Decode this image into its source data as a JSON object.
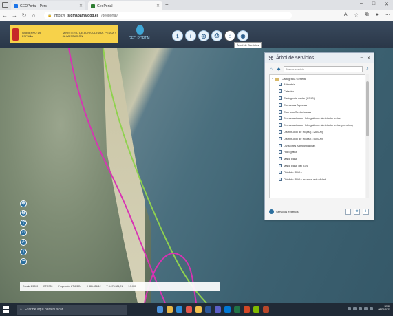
{
  "browser": {
    "tabs": [
      {
        "label": "GEOPortal · Pers",
        "active": false
      },
      {
        "label": "GeoPortal",
        "active": true
      }
    ],
    "url_scheme": "https://",
    "url_host": "sigmapama.gob.es",
    "url_path": "/geoportal/",
    "new_tab": "+",
    "window_buttons": [
      "–",
      "□",
      "✕"
    ]
  },
  "header": {
    "gov_line1": "GOBIERNO DE ESPAÑA",
    "gov_line2": "MINISTERIO DE AGRICULTURA, PESCA Y ALIMENTACIÓN",
    "geo_name": "GEO PORTAL",
    "toolbar_icons": [
      "info-circle-icon",
      "info-icon",
      "layers-icon",
      "print-icon",
      "services-tree-icon",
      "globe-icon"
    ],
    "tooltip": "Árbol de Servicios"
  },
  "map": {
    "controls": [
      "⊕",
      "⊖",
      "?",
      "⌂",
      "🔍",
      "+",
      "−"
    ],
    "coords": {
      "scale_label": "Escala 1:5000",
      "datum": "ETRS89",
      "projection": "Proyección UTM 30N",
      "x": "X 486.456,12",
      "y": "Y 4.075.304,21",
      "zoom": "1:5.000"
    }
  },
  "panel": {
    "title": "Árbol de servicios",
    "search_placeholder": "Buscar servicio...",
    "root": "Cartografía General",
    "items": [
      "Altimetría",
      "Catastro",
      "Cartografía raster (CNIG)",
      "Comarcas Agrarias",
      "Cuencas Sectorizadas",
      "Demarcaciones Hidrográficas (ámbito terrestre)",
      "Demarcaciones Hidrográficas (ámbito terrestre y marino)",
      "Distribución de Hojas (1:25.000)",
      "Distribución de Hojas (1:50.000)",
      "Divisiones Administrativas",
      "Hidrografía",
      "Mapa Base",
      "Mapa Base del IGN",
      "Ortofoto PNOA",
      "Ortofoto PNOA máxima actualidad"
    ],
    "footer_label": "Servicios externos"
  },
  "taskbar": {
    "search_placeholder": "Escribe aquí para buscar",
    "time": "12:30",
    "date": "08/06/2021"
  }
}
